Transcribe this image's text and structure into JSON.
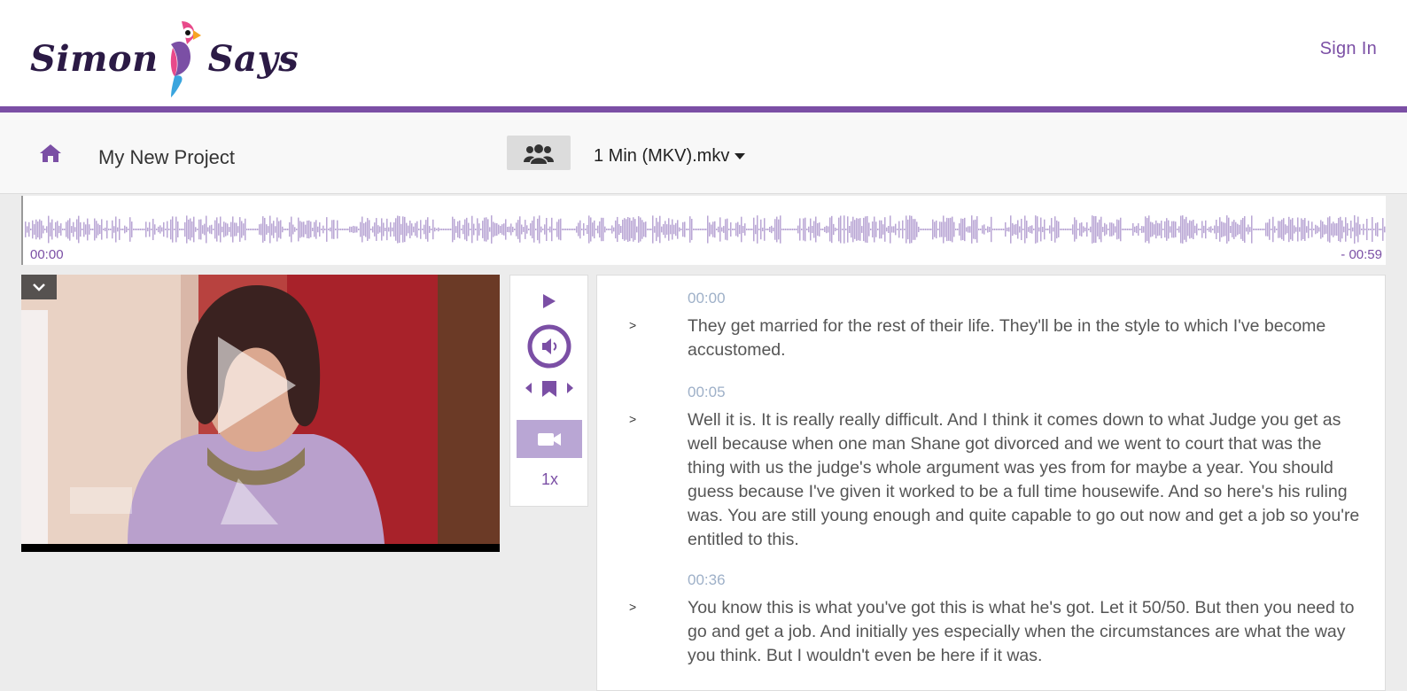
{
  "header": {
    "logo_left": "Simon",
    "logo_right": "Says",
    "sign_in": "Sign In"
  },
  "project": {
    "title": "My New Project",
    "file_name": "1 Min (MKV).mkv"
  },
  "waveform": {
    "start_time": "00:00",
    "end_time": "- 00:59"
  },
  "player": {
    "speed": "1x"
  },
  "transcript": {
    "paragraphs": [
      {
        "timestamp": "00:00",
        "text": "They get married for the rest of their life. They'll be in the style to which I've become accustomed."
      },
      {
        "timestamp": "00:05",
        "text": "Well it is. It is really really difficult. And I think it comes down to what Judge you get as well because when one man Shane got divorced and we went to court that was the thing with us the judge's whole argument was yes from for maybe a year. You should guess because I've given it worked to be a full time housewife. And so here's his ruling was. You are still young enough and quite capable to go out now and get a job so you're entitled to this."
      },
      {
        "timestamp": "00:36",
        "text": "You know this is what you've got this is what he's got. Let it 50/50. But then you need to go and get a job. And initially yes especially when the circumstances are what the way you think. But I wouldn't even be here if it was."
      }
    ]
  },
  "colors": {
    "brand_purple": "#7b4fa5",
    "waveform": "#b9a6d4",
    "timestamp": "#9eb0c8"
  },
  "icons": [
    "home-icon",
    "people-icon",
    "caret-down-icon",
    "play-icon",
    "volume-icon",
    "prev-icon",
    "bookmark-icon",
    "next-icon",
    "video-camera-icon",
    "chevron-down-icon",
    "parrot-logo"
  ]
}
